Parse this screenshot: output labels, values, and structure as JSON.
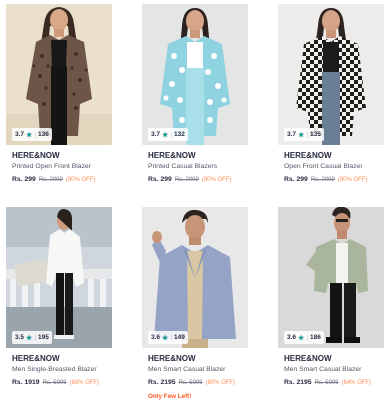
{
  "products": [
    {
      "rating": "3.7",
      "count": "136",
      "brand": "HERE&NOW",
      "title": "Printed Open Front Blazer",
      "price": "Rs. 299",
      "mrp": "Rs. 2999",
      "discount": "(90% OFF)",
      "urgency": ""
    },
    {
      "rating": "3.7",
      "count": "132",
      "brand": "HERE&NOW",
      "title": "Printed Casual Blazers",
      "price": "Rs. 299",
      "mrp": "Rs. 2999",
      "discount": "(90% OFF)",
      "urgency": ""
    },
    {
      "rating": "3.7",
      "count": "135",
      "brand": "HERE&NOW",
      "title": "Open Front Casual Blazer",
      "price": "Rs. 299",
      "mrp": "Rs. 2999",
      "discount": "(90% OFF)",
      "urgency": ""
    },
    {
      "rating": "3.5",
      "count": "195",
      "brand": "HERE&NOW",
      "title": "Men Single-Breasted Blazer",
      "price": "Rs. 1919",
      "mrp": "Rs. 5999",
      "discount": "(68% OFF)",
      "urgency": ""
    },
    {
      "rating": "3.6",
      "count": "149",
      "brand": "HERE&NOW",
      "title": "Men Smart Casual Blazer",
      "price": "Rs. 2195",
      "mrp": "Rs. 5999",
      "discount": "(60% OFF)",
      "urgency": "Only Few Left!"
    },
    {
      "rating": "3.6",
      "count": "186",
      "brand": "HERE&NOW",
      "title": "Men Smart Casual Blazer",
      "price": "Rs. 2195",
      "mrp": "Rs. 5999",
      "discount": "(64% OFF)",
      "urgency": ""
    }
  ],
  "icons": {
    "rating_star": "star-icon"
  },
  "colors": {
    "rating_star": "#14958f",
    "discount": "#ff905a",
    "urgency": "#ff5722"
  }
}
